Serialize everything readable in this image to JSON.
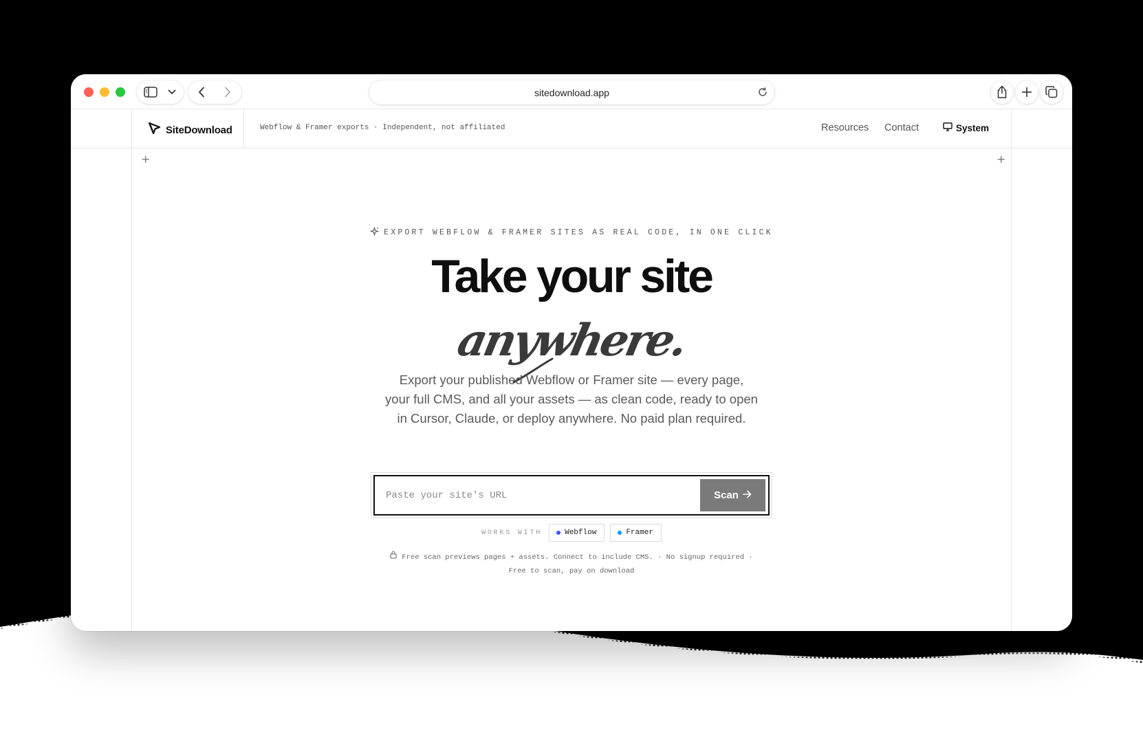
{
  "browser": {
    "url": "sitedownload.app"
  },
  "site": {
    "brand": "SiteDownload",
    "tagline": "Webflow & Framer exports · Independent, not affiliated",
    "nav": {
      "resources": "Resources",
      "contact": "Contact",
      "theme": "System"
    }
  },
  "hero": {
    "eyebrow": "EXPORT WEBFLOW & FRAMER SITES AS REAL CODE, IN ONE CLICK",
    "headline": "Take your site",
    "script_word": "anywhere.",
    "description": [
      "Export your published Webflow or Framer site — every page,",
      "your full CMS, and all your assets — as clean code, ready to open",
      "in Cursor, Claude, or deploy anywhere. No paid plan required."
    ]
  },
  "scan_form": {
    "placeholder": "Paste your site's URL",
    "value": "",
    "button_label": "Scan"
  },
  "works_with": {
    "label": "WORKS WITH",
    "platforms": [
      {
        "name": "Webflow",
        "color": "#4353ff"
      },
      {
        "name": "Framer",
        "color": "#0099ff"
      }
    ]
  },
  "fine_print": {
    "line1": "Free scan previews pages + assets. Connect to include CMS. · No signup required ·",
    "line2": "Free to scan, pay on download"
  },
  "icons": [
    "sidebar-icon",
    "chevron-down-icon",
    "back-arrow-icon",
    "forward-arrow-icon",
    "reload-icon",
    "share-icon",
    "new-tab-icon",
    "tabs-overview-icon",
    "cursor-logo-icon",
    "monitor-icon",
    "sparkle-icon",
    "arrow-right-icon",
    "lock-icon",
    "plus-icon"
  ],
  "colors": {
    "accent": "#7a7a7a",
    "text": "#0e0e0e",
    "muted": "#5a5a5a"
  }
}
